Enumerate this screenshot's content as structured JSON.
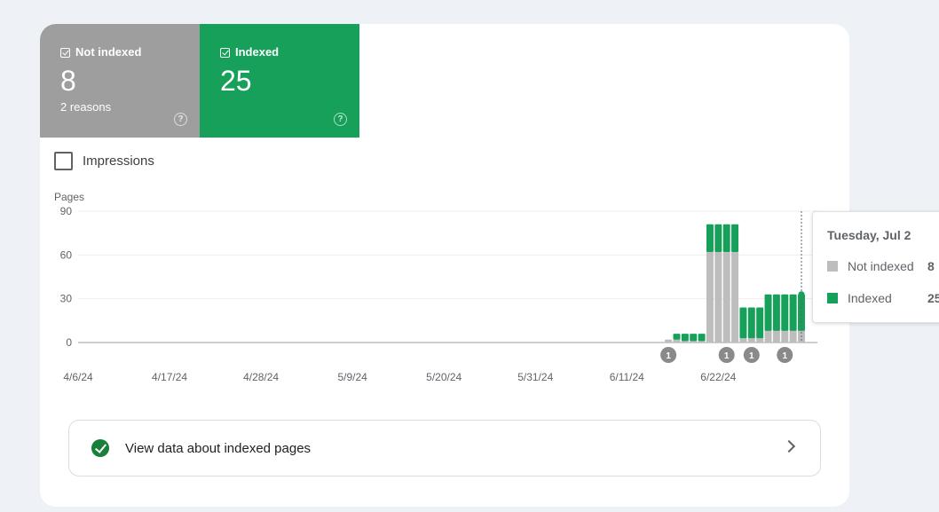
{
  "tiles": {
    "not_indexed": {
      "label": "Not indexed",
      "value": "8",
      "sub": "2 reasons",
      "help": "?",
      "color": "#9e9e9e"
    },
    "indexed": {
      "label": "Indexed",
      "value": "25",
      "help": "?",
      "color": "#16a05a"
    }
  },
  "impressions": {
    "label": "Impressions",
    "checked": false
  },
  "chart_data": {
    "type": "bar",
    "stacked": true,
    "ylabel": "Pages",
    "ylim": [
      0,
      90
    ],
    "yticks": [
      "90",
      "60",
      "30",
      "0"
    ],
    "xticks": [
      "4/6/24",
      "4/17/24",
      "4/28/24",
      "5/9/24",
      "5/20/24",
      "5/31/24",
      "6/11/24",
      "6/22/24"
    ],
    "x_start": "4/6/24",
    "x_end": "7/2/24",
    "series": [
      {
        "name": "Not indexed",
        "color": "#bdbdbd",
        "points": [
          [
            "6/16/24",
            2
          ],
          [
            "6/17/24",
            2
          ],
          [
            "6/18/24",
            1
          ],
          [
            "6/19/24",
            1
          ],
          [
            "6/20/24",
            1
          ],
          [
            "6/21/24",
            62
          ],
          [
            "6/22/24",
            62
          ],
          [
            "6/23/24",
            62
          ],
          [
            "6/24/24",
            62
          ],
          [
            "6/25/24",
            3
          ],
          [
            "6/26/24",
            3
          ],
          [
            "6/27/24",
            3
          ],
          [
            "6/28/24",
            8
          ],
          [
            "6/29/24",
            8
          ],
          [
            "6/30/24",
            8
          ],
          [
            "7/1/24",
            8
          ],
          [
            "7/2/24",
            8
          ]
        ]
      },
      {
        "name": "Indexed",
        "color": "#16a05a",
        "points": [
          [
            "6/16/24",
            0
          ],
          [
            "6/17/24",
            4
          ],
          [
            "6/18/24",
            5
          ],
          [
            "6/19/24",
            5
          ],
          [
            "6/20/24",
            5
          ],
          [
            "6/21/24",
            19
          ],
          [
            "6/22/24",
            19
          ],
          [
            "6/23/24",
            19
          ],
          [
            "6/24/24",
            19
          ],
          [
            "6/25/24",
            21
          ],
          [
            "6/26/24",
            21
          ],
          [
            "6/27/24",
            21
          ],
          [
            "6/28/24",
            25
          ],
          [
            "6/29/24",
            25
          ],
          [
            "6/30/24",
            25
          ],
          [
            "7/1/24",
            25
          ],
          [
            "7/2/24",
            25
          ]
        ]
      }
    ],
    "annotations": [
      {
        "date": "6/16/24",
        "label": "1"
      },
      {
        "date": "6/23/24",
        "label": "1"
      },
      {
        "date": "6/26/24",
        "label": "1"
      },
      {
        "date": "6/30/24",
        "label": "1"
      }
    ],
    "grid": true
  },
  "tooltip": {
    "date": "Tuesday, Jul 2",
    "rows": [
      {
        "label": "Not indexed",
        "value": "8",
        "color": "#bdbdbd"
      },
      {
        "label": "Indexed",
        "value": "25",
        "color": "#16a05a"
      }
    ]
  },
  "view_button": {
    "label": "View data about indexed pages"
  }
}
